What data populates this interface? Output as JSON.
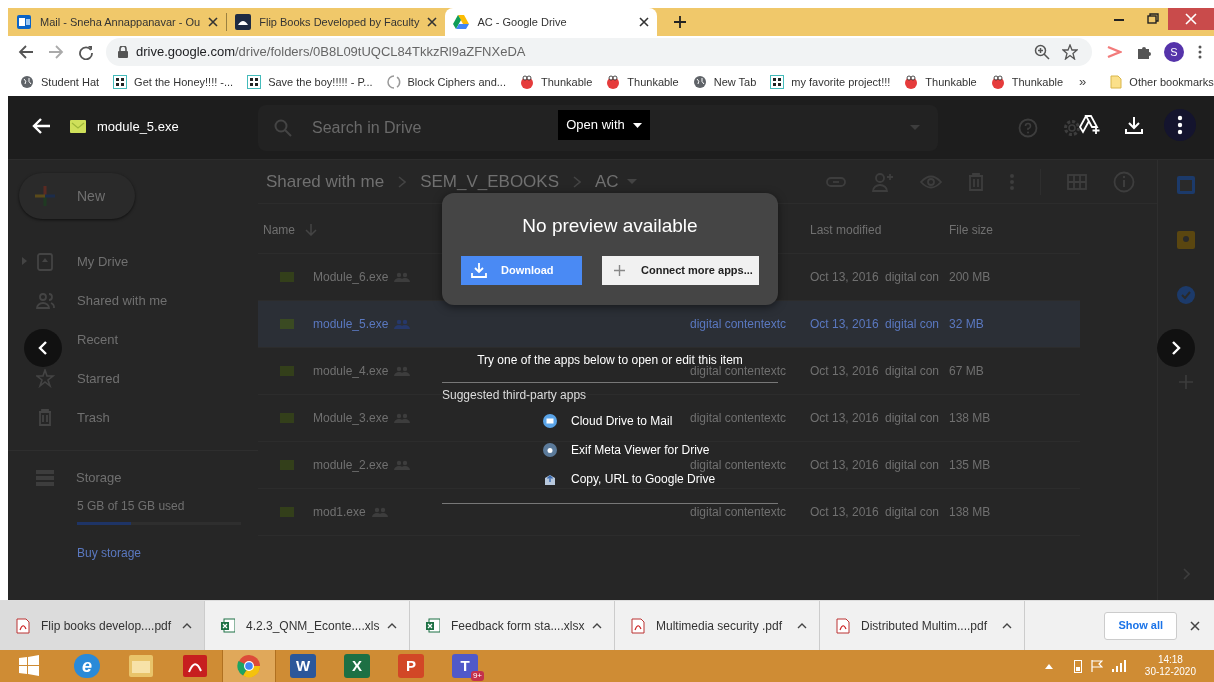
{
  "tabs": [
    {
      "kind": "mail",
      "title": "Mail - Sneha Annappanavar - Ou",
      "selected": false
    },
    {
      "kind": "books",
      "title": "Flip Books Developed by Faculty",
      "selected": false
    },
    {
      "kind": "drive",
      "title": "AC - Google Drive",
      "selected": true
    }
  ],
  "url": {
    "host": "drive.google.com",
    "path": "/drive/folders/0B8L09tUQCL84TkkzRl9aZFNXeDA"
  },
  "avatar": "S",
  "bookmarks": [
    {
      "kind": "globe",
      "label": "Student Hat"
    },
    {
      "kind": "grid",
      "label": "Get the Honey!!!! -..."
    },
    {
      "kind": "grid",
      "label": "Save the boy!!!!! - P..."
    },
    {
      "kind": "spinner",
      "label": "Block Ciphers and..."
    },
    {
      "kind": "thunkable",
      "label": "Thunkable"
    },
    {
      "kind": "thunkable",
      "label": "Thunkable"
    },
    {
      "kind": "globe",
      "label": "New Tab"
    },
    {
      "kind": "grid",
      "label": "my favorite project!!!"
    },
    {
      "kind": "thunkable",
      "label": "Thunkable"
    },
    {
      "kind": "thunkable",
      "label": "Thunkable"
    }
  ],
  "bookmarks_overflow": "»",
  "other_bookmarks": "Other bookmarks",
  "drive": {
    "search_placeholder": "Search in Drive",
    "new_button": "New",
    "nav": [
      {
        "kind": "drive",
        "label": "My Drive"
      },
      {
        "kind": "shared",
        "label": "Shared with me"
      },
      {
        "kind": "recent",
        "label": "Recent"
      },
      {
        "kind": "starred",
        "label": "Starred"
      },
      {
        "kind": "trash",
        "label": "Trash"
      }
    ],
    "storage": {
      "label": "Storage",
      "usage": "5 GB of 15 GB used",
      "level": 0.33,
      "buy": "Buy storage"
    },
    "breadcrumb": [
      "Shared with me",
      "SEM_V_EBOOKS",
      "AC"
    ],
    "columns": [
      "Name",
      "Last modified",
      "File size"
    ],
    "rows": [
      {
        "name": "Module_6.exe",
        "modified": "Oct 13, 2016",
        "modified_by": "digital con",
        "size": "200 MB",
        "selected": false
      },
      {
        "name": "module_5.exe",
        "owner": "digital contentextc",
        "modified": "Oct 13, 2016",
        "modified_by": "digital con",
        "size": "32 MB",
        "selected": true
      },
      {
        "name": "module_4.exe",
        "owner": "digital contentextc",
        "modified": "Oct 13, 2016",
        "modified_by": "digital con",
        "size": "67 MB",
        "selected": false
      },
      {
        "name": "Module_3.exe",
        "owner": "digital contentextc",
        "modified": "Oct 13, 2016",
        "modified_by": "digital con",
        "size": "138 MB",
        "selected": false
      },
      {
        "name": "module_2.exe",
        "owner": "digital contentextc",
        "modified": "Oct 13, 2016",
        "modified_by": "digital con",
        "size": "135 MB",
        "selected": false
      },
      {
        "name": "mod1.exe",
        "owner": "digital contentextc",
        "modified": "Oct 13, 2016",
        "modified_by": "digital con",
        "size": "138 MB",
        "selected": false
      }
    ]
  },
  "viewer": {
    "file_name": "module_5.exe",
    "open_with": "Open with",
    "dialog_title": "No preview available",
    "download": "Download",
    "connect": "Connect more apps...",
    "prompt": "Try one of the apps below to open or edit this item",
    "suggested_heading": "Suggested third-party apps",
    "apps": [
      {
        "kind": "mail",
        "name": "Cloud Drive to Mail"
      },
      {
        "kind": "camera",
        "name": "Exif Meta Viewer for Drive"
      },
      {
        "kind": "upload",
        "name": "Copy, URL to Google Drive"
      }
    ]
  },
  "downloads": {
    "items": [
      {
        "kind": "pdf",
        "name": "Flip books develop....pdf",
        "selected": true
      },
      {
        "kind": "xls",
        "name": "4.2.3_QNM_Econte....xls",
        "selected": false
      },
      {
        "kind": "xls",
        "name": "Feedback form sta....xlsx",
        "selected": false
      },
      {
        "kind": "pdf",
        "name": "Multimedia security .pdf",
        "selected": false
      },
      {
        "kind": "pdf",
        "name": "Distributed Multim....pdf",
        "selected": false
      }
    ],
    "show_all": "Show all"
  },
  "taskbar": {
    "apps": [
      {
        "kind": "ie",
        "glyph": "e",
        "selected": false
      },
      {
        "kind": "explorer",
        "selected": false
      },
      {
        "kind": "acrobat",
        "selected": false
      },
      {
        "kind": "chrome",
        "selected": true
      },
      {
        "kind": "word",
        "glyph": "W",
        "selected": false
      },
      {
        "kind": "excel",
        "glyph": "X",
        "selected": false
      },
      {
        "kind": "powerpoint",
        "glyph": "P",
        "selected": false
      },
      {
        "kind": "teams",
        "glyph": "T",
        "badge": "9+",
        "selected": false
      }
    ],
    "time": "14:18",
    "date": "30-12-2020"
  }
}
